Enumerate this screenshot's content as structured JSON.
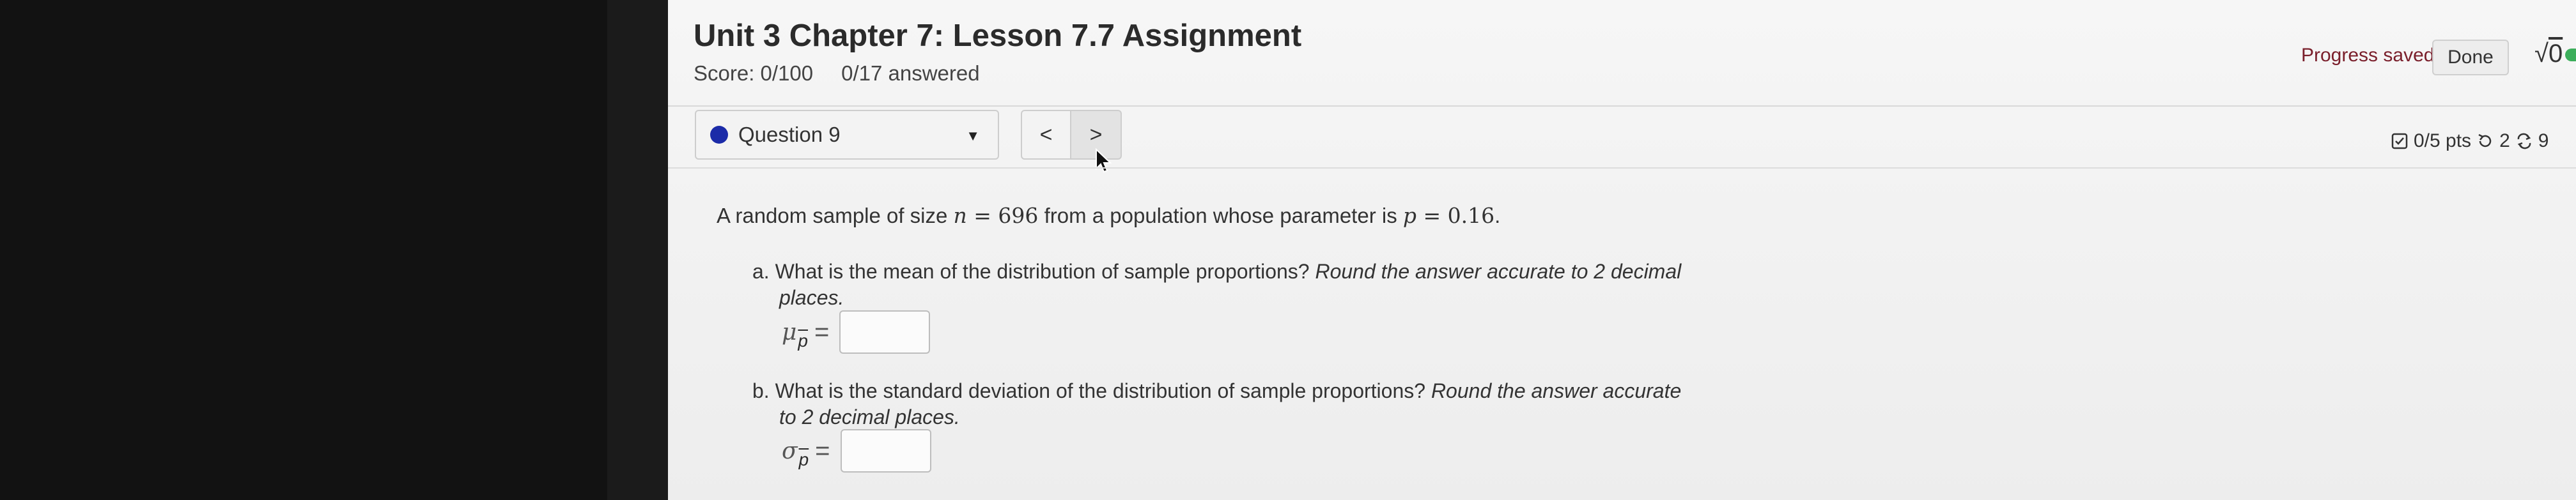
{
  "header": {
    "title": "Unit 3 Chapter 7: Lesson 7.7 Assignment",
    "score": "Score: 0/100",
    "answered": "0/17 answered",
    "progress": "Progress saved",
    "done_label": "Done",
    "sqrt_label": "0"
  },
  "nav": {
    "question_label": "Question 9",
    "prev": "<",
    "next": ">",
    "pts": "0/5 pts",
    "retries": "2",
    "attempts": "9"
  },
  "question": {
    "intro_a": "A random sample of size ",
    "n_var": "n",
    "n_eq": " = 696",
    "intro_b": " from a population whose parameter is ",
    "p_var": "p",
    "p_eq": " = 0.16",
    "intro_end": ".",
    "part_a_lead": "a. What is the mean of the distribution of sample proportions?",
    "part_a_instr_1": "Round the answer accurate to 2 decimal",
    "part_a_instr_2": "places.",
    "part_a_symbol": "μ",
    "part_b_lead": "b. What is the standard deviation of the distribution of sample proportions?",
    "part_b_instr_1": "Round the answer accurate",
    "part_b_instr_2": "to 2 decimal places.",
    "part_b_symbol": "σ",
    "sub_symbol": "p",
    "equals": "="
  },
  "colors": {
    "question_dot": "#1b2ba8",
    "progress_text": "#7a1f2b",
    "toggle": "#3cae5b"
  },
  "icons": [
    "chevron-down-icon",
    "chevron-left-icon",
    "chevron-right-icon",
    "cursor-arrow-icon",
    "checkbox-icon",
    "retry-icon",
    "attempts-icon"
  ]
}
